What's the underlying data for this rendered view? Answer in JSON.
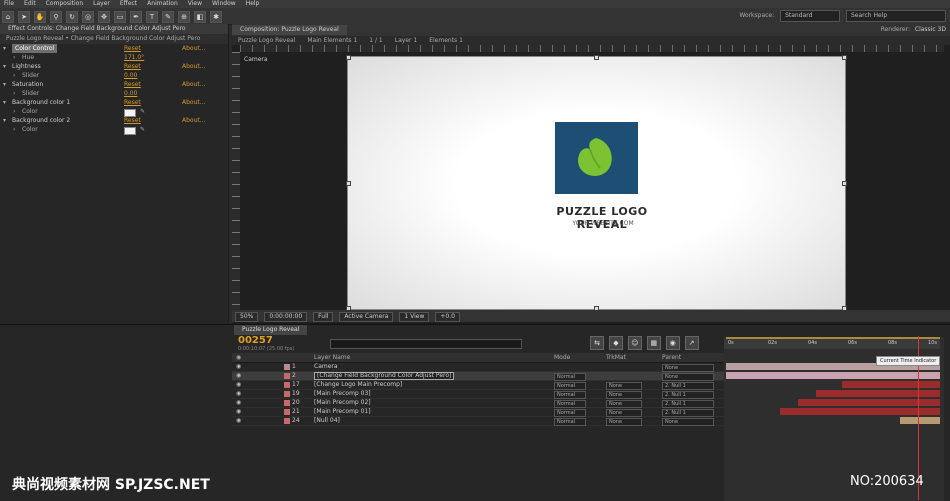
{
  "menubar": [
    "File",
    "Edit",
    "Composition",
    "Layer",
    "Effect",
    "Animation",
    "View",
    "Window",
    "Help"
  ],
  "toolbar": {
    "tools": [
      "home-icon",
      "arrow-icon",
      "hand-icon",
      "zoom-icon",
      "rotate-icon",
      "camera-icon",
      "pan-icon",
      "rect-icon",
      "pen-icon",
      "text-icon",
      "brush-icon",
      "stamp-icon",
      "eraser-icon",
      "puppet-icon"
    ],
    "workspace_label": "Workspace:",
    "workspace_value": "Standard",
    "search_placeholder": "Search Help"
  },
  "effects_panel": {
    "tab": "Effect Controls: Change Field Background Color Adjust Pero",
    "subtitle": "Puzzle Logo Reveal • Change Field Background Color Adjust Pero",
    "rows": [
      {
        "name": "Color Control",
        "value": "Reset",
        "about": "About...",
        "type": "header",
        "selected": true
      },
      {
        "name": "Hue",
        "value": "171.0°",
        "about": "",
        "type": "sub"
      },
      {
        "name": "Lightness",
        "value": "Reset",
        "about": "About...",
        "type": "header"
      },
      {
        "name": "Slider",
        "value": "0.00",
        "about": "",
        "type": "sub"
      },
      {
        "name": "Saturation",
        "value": "Reset",
        "about": "About...",
        "type": "header"
      },
      {
        "name": "Slider",
        "value": "0.00",
        "about": "",
        "type": "sub"
      },
      {
        "name": "Background color 1",
        "value": "Reset",
        "about": "About...",
        "type": "header"
      },
      {
        "name": "Color",
        "value": "",
        "about": "",
        "type": "color"
      },
      {
        "name": "Background color 2",
        "value": "Reset",
        "about": "About...",
        "type": "header"
      },
      {
        "name": "Color",
        "value": "",
        "about": "",
        "type": "color"
      }
    ]
  },
  "comp_panel": {
    "tabs": [
      "Composition: Puzzle Logo Reveal"
    ],
    "breadcrumbs": [
      "Puzzle Logo Reveal",
      "Main Elements 1",
      "1 / 1",
      "Layer 1",
      "Elements 1"
    ],
    "view_label": "Camera",
    "renderer": "Renderer:",
    "renderer_value": "Classic 3D",
    "footer": [
      "50%",
      "0:00:00:00",
      "Full",
      "Active Camera",
      "1 View",
      "+0.0"
    ]
  },
  "canvas": {
    "brand": "PUZZLE LOGO REVEAL",
    "website": "YOUR WEBSITE.COM",
    "logo_color": "#1d4e73",
    "leaf_color": "#7dc232"
  },
  "timeline": {
    "tab": "Puzzle Logo Reveal",
    "timecode": "00257",
    "fps": "0:00:10:07 (25.00 fps)",
    "header": {
      "source": "Layer Name",
      "mode": "Mode",
      "trkmat": "TrkMat",
      "parent": "Parent"
    },
    "layers": [
      {
        "num": "1",
        "name": "Camera",
        "mode": "",
        "mat": "",
        "parent": "None",
        "color": "#b58d8d"
      },
      {
        "num": "2",
        "name": "[Change Field Background Color Adjust Pero]",
        "mode": "Normal",
        "mat": "",
        "parent": "None",
        "color": "#c76a6a"
      },
      {
        "num": "17",
        "name": "[Change Logo Main Precomp]",
        "mode": "Normal",
        "mat": "None",
        "parent": "2. Null 1",
        "color": "#c76a6a"
      },
      {
        "num": "19",
        "name": "[Main Precomp 03]",
        "mode": "Normal",
        "mat": "None",
        "parent": "2. Null 1",
        "color": "#c76a6a"
      },
      {
        "num": "20",
        "name": "[Main Precomp 02]",
        "mode": "Normal",
        "mat": "None",
        "parent": "2. Null 1",
        "color": "#c76a6a"
      },
      {
        "num": "21",
        "name": "[Main Precomp 01]",
        "mode": "Normal",
        "mat": "None",
        "parent": "2. Null 1",
        "color": "#c76a6a"
      },
      {
        "num": "24",
        "name": "[Null 04]",
        "mode": "Normal",
        "mat": "None",
        "parent": "None",
        "color": "#c76a6a"
      }
    ],
    "ruler_ticks": [
      "0s",
      "02s",
      "04s",
      "06s",
      "08s",
      "10s"
    ],
    "cti_tooltip": "Current Time Indicator"
  },
  "watermark": {
    "left": "典尚视频素材网 SP.JZSC.NET",
    "right": "NO:200634"
  }
}
